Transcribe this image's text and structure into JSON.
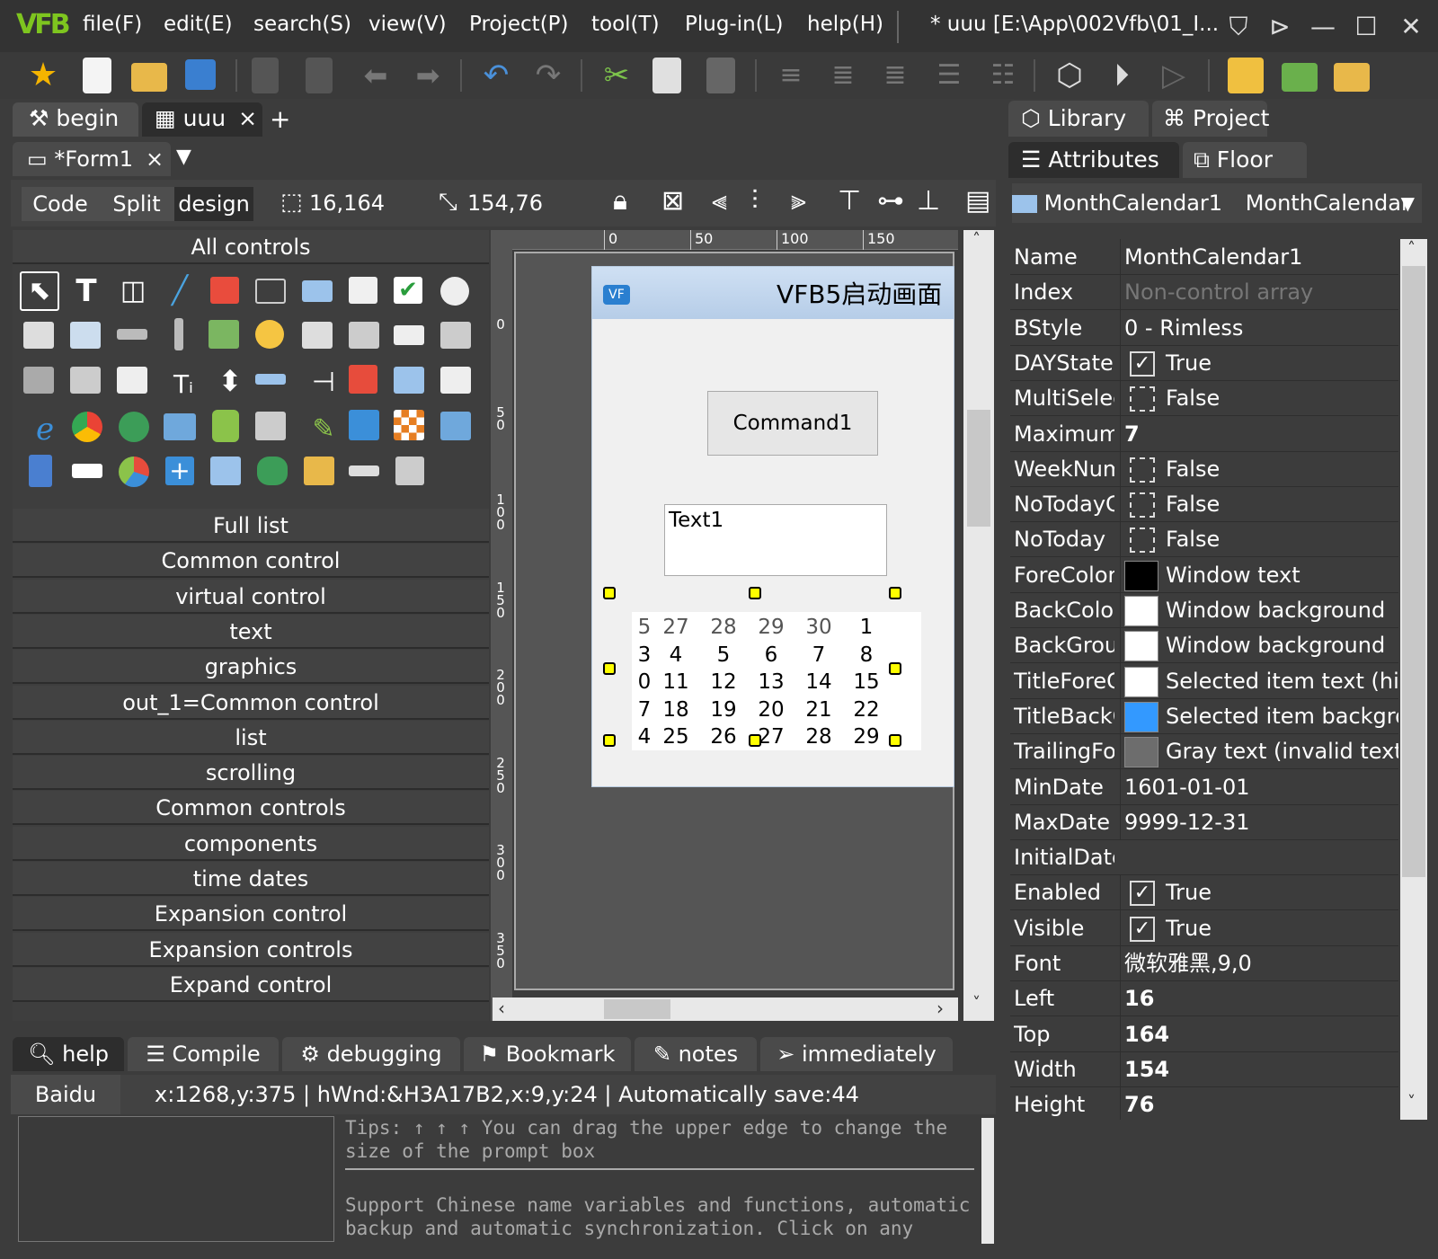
{
  "titlebar": {
    "logo": "VFB",
    "menus": [
      "file(F)",
      "edit(E)",
      "search(S)",
      "view(V)",
      "Project(P)",
      "tool(T)",
      "Plug-in(L)",
      "help(H)"
    ],
    "window_title": "* uuu [E:\\App\\002Vfb\\01_I..."
  },
  "doc_tabs": [
    {
      "label": "begin"
    },
    {
      "label": "uuu",
      "close": "×"
    }
  ],
  "add_tab": "+",
  "form_tab": {
    "label": "*Form1",
    "close": "×",
    "dropdown": "▼"
  },
  "view_modes": [
    "Code",
    "Split",
    "design"
  ],
  "position": "16,164",
  "size": "154,76",
  "left_panel": {
    "header": "All controls",
    "categories": [
      "Full list",
      "Common control",
      "virtual control",
      "text",
      "graphics",
      "out_1=Common control",
      "list",
      "scrolling",
      "Common controls",
      "components",
      "time dates",
      "Expansion control",
      "Expansion controls",
      "Expand control"
    ]
  },
  "ruler": {
    "h": [
      "0",
      "50",
      "100",
      "150"
    ],
    "v": [
      "0",
      "50",
      "100",
      "150",
      "200",
      "250",
      "300",
      "350"
    ]
  },
  "form": {
    "title": "VFB5启动画面",
    "command": "Command1",
    "text": "Text1",
    "calendar": [
      [
        "5",
        "27",
        "28",
        "29",
        "30",
        "1"
      ],
      [
        "3",
        "4",
        "5",
        "6",
        "7",
        "8"
      ],
      [
        "0",
        "11",
        "12",
        "13",
        "14",
        "15"
      ],
      [
        "7",
        "18",
        "19",
        "20",
        "21",
        "22"
      ],
      [
        "4",
        "25",
        "26",
        "27",
        "28",
        "29"
      ]
    ]
  },
  "bottom_tabs": [
    "help",
    "Compile",
    "debugging",
    "Bookmark",
    "notes",
    "immediately"
  ],
  "status": {
    "left": "Baidu",
    "text": "x:1268,y:375 | hWnd:&H3A17B2,x:9,y:24 | Automatically save:44"
  },
  "tips": {
    "line1": "Tips: ↑ ↑ ↑ You can drag the upper edge to change the size of the prompt box",
    "line2": "Support Chinese name variables and functions, automatic backup and automatic synchronization. Click on any"
  },
  "right_tabs": {
    "top": [
      "Library",
      "Project"
    ],
    "second": [
      "Attributes",
      "Floor"
    ]
  },
  "object_selector": {
    "name": "MonthCalendar1",
    "type": "MonthCalendar"
  },
  "properties": [
    {
      "name": "Name",
      "value": "MonthCalendar1"
    },
    {
      "name": "Index",
      "value": "Non-control array",
      "dim": true
    },
    {
      "name": "BStyle",
      "value": "0 - Rimless"
    },
    {
      "name": "DAYState",
      "value": "True",
      "check": "on"
    },
    {
      "name": "MultiSelect",
      "value": "False",
      "check": "off"
    },
    {
      "name": "Maximum",
      "value": "7",
      "bold": true
    },
    {
      "name": "WeekNumbers",
      "value": "False",
      "check": "off"
    },
    {
      "name": "NoTodayCircle",
      "value": "False",
      "check": "off"
    },
    {
      "name": "NoToday",
      "value": "False",
      "check": "off"
    },
    {
      "name": "ForeColor",
      "value": "Window text",
      "swatch": "#000000"
    },
    {
      "name": "BackColor",
      "value": "Window background",
      "swatch": "#ffffff"
    },
    {
      "name": "BackGround",
      "value": "Window background",
      "swatch": "#ffffff"
    },
    {
      "name": "TitleForeColor",
      "value": "Selected item text (highlight)",
      "swatch": "#ffffff"
    },
    {
      "name": "TitleBackColor",
      "value": "Selected item background",
      "swatch": "#3399ff"
    },
    {
      "name": "TrailingForeColor",
      "value": "Gray text (invalid text)",
      "swatch": "#6d6d6d"
    },
    {
      "name": "MinDate",
      "value": "1601-01-01"
    },
    {
      "name": "MaxDate",
      "value": "9999-12-31"
    },
    {
      "name": "InitialDate",
      "value": ""
    },
    {
      "name": "Enabled",
      "value": "True",
      "check": "on"
    },
    {
      "name": "Visible",
      "value": "True",
      "check": "on"
    },
    {
      "name": "Font",
      "value": "微软雅黑,9,0"
    },
    {
      "name": "Left",
      "value": "16",
      "bold": true
    },
    {
      "name": "Top",
      "value": "164",
      "bold": true
    },
    {
      "name": "Width",
      "value": "154",
      "bold": true
    },
    {
      "name": "Height",
      "value": "76",
      "bold": true
    }
  ],
  "colors": {
    "accent": "#7ec51f",
    "panel": "#3c3c3c",
    "handle": "#ffff00"
  }
}
